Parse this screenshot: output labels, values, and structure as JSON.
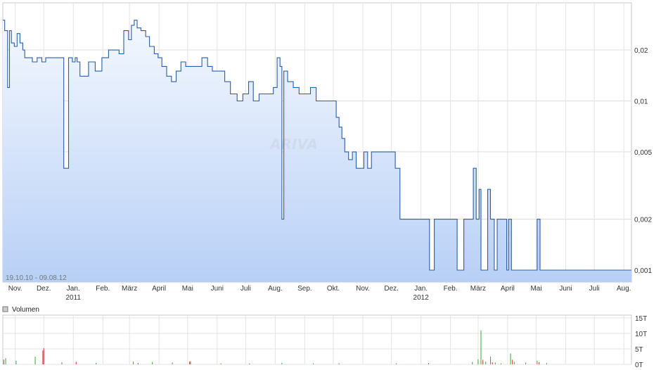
{
  "chart_data": [
    {
      "type": "line",
      "title": "",
      "xlabel": "",
      "ylabel": "",
      "y_scale": "log",
      "grid": true,
      "x_domain": [
        "2010-10-19",
        "2012-08-09"
      ],
      "ylim": [
        0.00085,
        0.038
      ],
      "range_label": "19.10.10 - 09.08.12",
      "watermark": "ARIVA",
      "line_color": "#2a5da8",
      "fill_top_color": "#f4f8fe",
      "fill_bottom_color": "#b8d0f6",
      "y_ticks": [
        {
          "value": 0.02,
          "label": "0,02"
        },
        {
          "value": 0.01,
          "label": "0,01"
        },
        {
          "value": 0.005,
          "label": "0,005"
        },
        {
          "value": 0.002,
          "label": "0,002"
        },
        {
          "value": 0.001,
          "label": "0,001"
        }
      ],
      "x_ticks": [
        {
          "date": "2010-11-01",
          "label": "Nov."
        },
        {
          "date": "2010-12-01",
          "label": "Dez."
        },
        {
          "date": "2011-01-01",
          "label": "Jan.",
          "year": "2011"
        },
        {
          "date": "2011-02-01",
          "label": "Feb."
        },
        {
          "date": "2011-03-01",
          "label": "März"
        },
        {
          "date": "2011-04-01",
          "label": "April"
        },
        {
          "date": "2011-05-01",
          "label": "Mai"
        },
        {
          "date": "2011-06-01",
          "label": "Juni"
        },
        {
          "date": "2011-07-01",
          "label": "Juli"
        },
        {
          "date": "2011-08-01",
          "label": "Aug."
        },
        {
          "date": "2011-09-01",
          "label": "Sep."
        },
        {
          "date": "2011-10-01",
          "label": "Okt."
        },
        {
          "date": "2011-11-01",
          "label": "Nov."
        },
        {
          "date": "2011-12-01",
          "label": "Dez."
        },
        {
          "date": "2012-01-01",
          "label": "Jan.",
          "year": "2012"
        },
        {
          "date": "2012-02-01",
          "label": "Feb."
        },
        {
          "date": "2012-03-01",
          "label": "März"
        },
        {
          "date": "2012-04-01",
          "label": "April"
        },
        {
          "date": "2012-05-01",
          "label": "Mai"
        },
        {
          "date": "2012-06-01",
          "label": "Juni"
        },
        {
          "date": "2012-07-01",
          "label": "Juli"
        },
        {
          "date": "2012-08-01",
          "label": "Aug."
        }
      ],
      "x": [
        "2010-10-19",
        "2010-10-21",
        "2010-10-24",
        "2010-10-26",
        "2010-10-28",
        "2010-10-31",
        "2010-11-03",
        "2010-11-06",
        "2010-11-09",
        "2010-11-11",
        "2010-11-15",
        "2010-11-19",
        "2010-11-24",
        "2010-11-29",
        "2010-12-03",
        "2010-12-08",
        "2010-12-13",
        "2010-12-17",
        "2010-12-22",
        "2010-12-27",
        "2010-12-31",
        "2011-01-03",
        "2011-01-05",
        "2011-01-08",
        "2011-01-11",
        "2011-01-17",
        "2011-01-24",
        "2011-01-31",
        "2011-02-07",
        "2011-02-14",
        "2011-02-18",
        "2011-02-23",
        "2011-02-28",
        "2011-03-03",
        "2011-03-06",
        "2011-03-09",
        "2011-03-13",
        "2011-03-18",
        "2011-03-22",
        "2011-03-27",
        "2011-03-31",
        "2011-04-04",
        "2011-04-09",
        "2011-04-14",
        "2011-04-19",
        "2011-04-24",
        "2011-04-29",
        "2011-05-05",
        "2011-05-10",
        "2011-05-16",
        "2011-05-22",
        "2011-05-27",
        "2011-06-02",
        "2011-06-09",
        "2011-06-15",
        "2011-06-22",
        "2011-06-28",
        "2011-07-04",
        "2011-07-09",
        "2011-07-15",
        "2011-07-20",
        "2011-07-25",
        "2011-07-30",
        "2011-08-03",
        "2011-08-06",
        "2011-08-08",
        "2011-08-10",
        "2011-08-14",
        "2011-08-20",
        "2011-08-26",
        "2011-09-01",
        "2011-09-07",
        "2011-09-13",
        "2011-09-19",
        "2011-09-25",
        "2011-10-01",
        "2011-10-04",
        "2011-10-07",
        "2011-10-10",
        "2011-10-13",
        "2011-10-17",
        "2011-10-21",
        "2011-10-25",
        "2011-10-29",
        "2011-11-02",
        "2011-11-06",
        "2011-11-10",
        "2011-11-15",
        "2011-11-20",
        "2011-11-25",
        "2011-11-29",
        "2011-12-02",
        "2011-12-05",
        "2011-12-10",
        "2011-12-18",
        "2011-12-28",
        "2012-01-05",
        "2012-01-08",
        "2012-01-10",
        "2012-01-15",
        "2012-01-25",
        "2012-02-05",
        "2012-02-08",
        "2012-02-10",
        "2012-02-15",
        "2012-02-22",
        "2012-02-25",
        "2012-02-28",
        "2012-03-02",
        "2012-03-04",
        "2012-03-08",
        "2012-03-11",
        "2012-03-14",
        "2012-03-18",
        "2012-03-21",
        "2012-03-24",
        "2012-03-28",
        "2012-03-31",
        "2012-04-02",
        "2012-04-05",
        "2012-04-10",
        "2012-04-20",
        "2012-04-30",
        "2012-05-02",
        "2012-05-05",
        "2012-05-15",
        "2012-06-01",
        "2012-06-20",
        "2012-07-10",
        "2012-08-09"
      ],
      "y": [
        0.03,
        0.026,
        0.012,
        0.026,
        0.022,
        0.021,
        0.025,
        0.022,
        0.02,
        0.018,
        0.018,
        0.017,
        0.018,
        0.017,
        0.018,
        0.018,
        0.018,
        0.018,
        0.004,
        0.018,
        0.017,
        0.018,
        0.017,
        0.014,
        0.014,
        0.017,
        0.015,
        0.018,
        0.02,
        0.02,
        0.019,
        0.026,
        0.023,
        0.028,
        0.03,
        0.027,
        0.026,
        0.024,
        0.021,
        0.019,
        0.018,
        0.016,
        0.014,
        0.013,
        0.015,
        0.017,
        0.016,
        0.016,
        0.016,
        0.018,
        0.016,
        0.015,
        0.015,
        0.013,
        0.011,
        0.01,
        0.011,
        0.013,
        0.01,
        0.011,
        0.011,
        0.011,
        0.012,
        0.018,
        0.016,
        0.002,
        0.015,
        0.013,
        0.012,
        0.011,
        0.011,
        0.012,
        0.01,
        0.01,
        0.01,
        0.01,
        0.008,
        0.007,
        0.006,
        0.005,
        0.0045,
        0.005,
        0.004,
        0.004,
        0.005,
        0.004,
        0.005,
        0.005,
        0.005,
        0.005,
        0.005,
        0.005,
        0.004,
        0.002,
        0.002,
        0.002,
        0.002,
        0.002,
        0.001,
        0.002,
        0.002,
        0.002,
        0.001,
        0.001,
        0.002,
        0.002,
        0.004,
        0.002,
        0.003,
        0.001,
        0.001,
        0.003,
        0.002,
        0.001,
        0.002,
        0.002,
        0.002,
        0.001,
        0.002,
        0.001,
        0.001,
        0.001,
        0.001,
        0.002,
        0.001,
        0.001,
        0.001,
        0.001,
        0.001,
        0.001
      ]
    },
    {
      "type": "bar",
      "title": "",
      "legend": "Volumen",
      "y_ticks": [
        "15T",
        "10T",
        "5T",
        "0T"
      ],
      "ylim": [
        0,
        15000
      ],
      "up_color": "#33aa33",
      "down_color": "#cc3333",
      "bars": [
        {
          "date": "2010-10-20",
          "value": 1500,
          "dir": "down"
        },
        {
          "date": "2010-10-22",
          "value": 2000,
          "dir": "up"
        },
        {
          "date": "2010-11-02",
          "value": 1200,
          "dir": "up"
        },
        {
          "date": "2010-11-22",
          "value": 2500,
          "dir": "up"
        },
        {
          "date": "2010-11-30",
          "value": 4500,
          "dir": "down"
        },
        {
          "date": "2010-12-01",
          "value": 5200,
          "dir": "down"
        },
        {
          "date": "2010-12-20",
          "value": 700,
          "dir": "up"
        },
        {
          "date": "2011-01-04",
          "value": 800,
          "dir": "down"
        },
        {
          "date": "2011-01-25",
          "value": 500,
          "dir": "up"
        },
        {
          "date": "2011-03-05",
          "value": 900,
          "dir": "up"
        },
        {
          "date": "2011-03-10",
          "value": 400,
          "dir": "down"
        },
        {
          "date": "2011-03-25",
          "value": 800,
          "dir": "up"
        },
        {
          "date": "2011-04-15",
          "value": 600,
          "dir": "up"
        },
        {
          "date": "2011-05-03",
          "value": 900,
          "dir": "up"
        },
        {
          "date": "2011-05-04",
          "value": 1000,
          "dir": "down"
        },
        {
          "date": "2011-06-05",
          "value": 300,
          "dir": "up"
        },
        {
          "date": "2011-07-05",
          "value": 300,
          "dir": "down"
        },
        {
          "date": "2011-08-08",
          "value": 500,
          "dir": "up"
        },
        {
          "date": "2011-09-10",
          "value": 300,
          "dir": "up"
        },
        {
          "date": "2011-10-07",
          "value": 300,
          "dir": "down"
        },
        {
          "date": "2011-12-06",
          "value": 300,
          "dir": "up"
        },
        {
          "date": "2012-01-09",
          "value": 400,
          "dir": "down"
        },
        {
          "date": "2012-02-24",
          "value": 800,
          "dir": "up"
        },
        {
          "date": "2012-03-01",
          "value": 1600,
          "dir": "up"
        },
        {
          "date": "2012-03-04",
          "value": 11000,
          "dir": "up"
        },
        {
          "date": "2012-03-06",
          "value": 1500,
          "dir": "down"
        },
        {
          "date": "2012-03-09",
          "value": 900,
          "dir": "up"
        },
        {
          "date": "2012-03-14",
          "value": 2500,
          "dir": "up"
        },
        {
          "date": "2012-03-16",
          "value": 700,
          "dir": "down"
        },
        {
          "date": "2012-03-19",
          "value": 600,
          "dir": "up"
        },
        {
          "date": "2012-03-25",
          "value": 300,
          "dir": "up"
        },
        {
          "date": "2012-04-04",
          "value": 3500,
          "dir": "up"
        },
        {
          "date": "2012-04-06",
          "value": 1500,
          "dir": "down"
        },
        {
          "date": "2012-04-08",
          "value": 800,
          "dir": "up"
        },
        {
          "date": "2012-04-20",
          "value": 600,
          "dir": "up"
        },
        {
          "date": "2012-05-02",
          "value": 1200,
          "dir": "up"
        },
        {
          "date": "2012-05-04",
          "value": 700,
          "dir": "down"
        },
        {
          "date": "2012-05-12",
          "value": 400,
          "dir": "up"
        }
      ]
    }
  ]
}
